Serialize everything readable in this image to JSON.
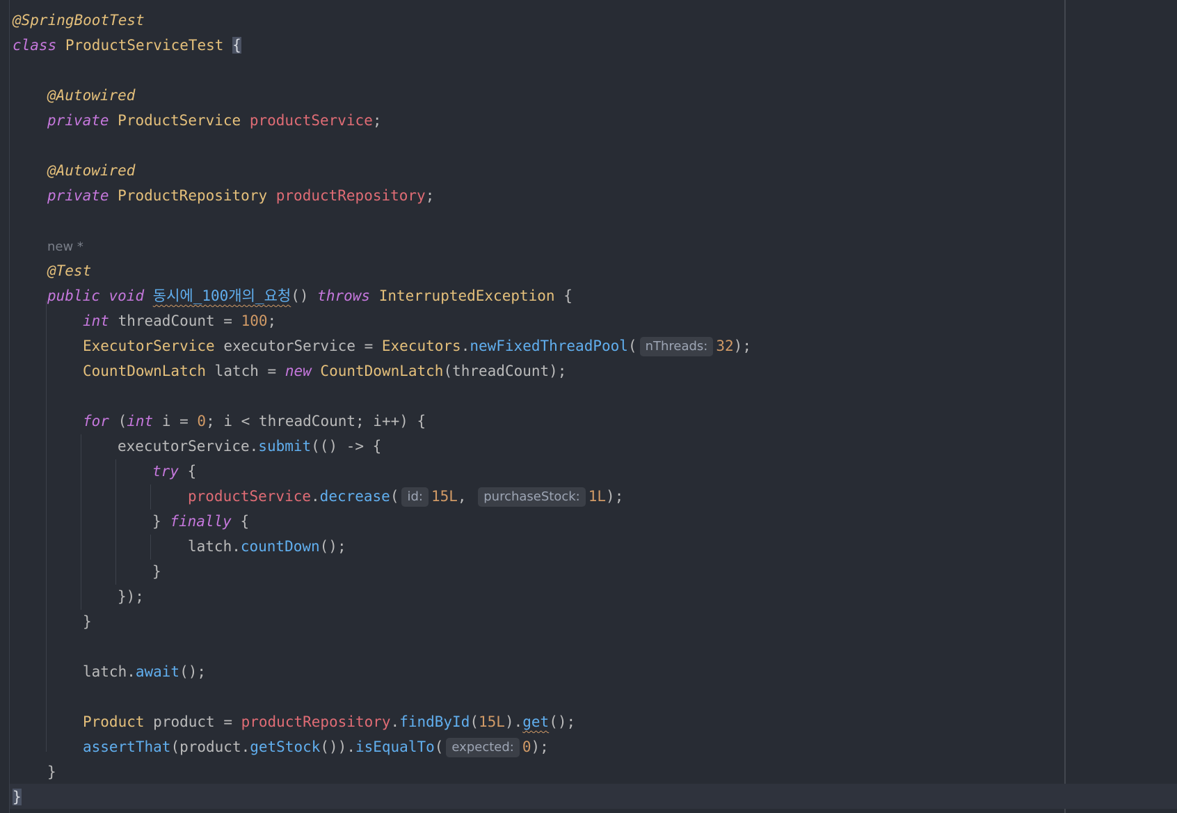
{
  "editor": {
    "language": "Java",
    "lines": {
      "l1_ann": "@SpringBootTest",
      "l2_kw": "class",
      "l2_name": "ProductServiceTest",
      "l2_brace": "{",
      "l4_ann": "@Autowired",
      "l5_kw": "private",
      "l5_type": "ProductService",
      "l5_field": "productService",
      "l5_end": ";",
      "l7_ann": "@Autowired",
      "l8_kw": "private",
      "l8_type": "ProductRepository",
      "l8_field": "productRepository",
      "l8_end": ";",
      "l10_meta": "new *",
      "l11_ann": "@Test",
      "l12_kw1": "public",
      "l12_kw2": "void",
      "l12_method": "동시에_100개의_요청",
      "l12_parens": "()",
      "l12_kw3": "throws",
      "l12_type": "InterruptedException",
      "l12_brace": "{",
      "l13_kw": "int",
      "l13_var": "threadCount = ",
      "l13_num": "100",
      "l13_end": ";",
      "l14_type": "ExecutorService",
      "l14_var": "executorService = ",
      "l14_type2": "Executors",
      "l14_dot": ".",
      "l14_method": "newFixedThreadPool",
      "l14_open": "(",
      "l14_hint": "nThreads:",
      "l14_num": "32",
      "l14_end": ");",
      "l15_type": "CountDownLatch",
      "l15_var": "latch = ",
      "l15_kw": "new",
      "l15_type2": "CountDownLatch",
      "l15_end": "(threadCount);",
      "l17_kw": "for",
      "l17_open": "(",
      "l17_kw2": "int",
      "l17_mid1": "i = ",
      "l17_num": "0",
      "l17_mid2": "; i < threadCount; i++) {",
      "l18_var": "executorService.",
      "l18_method": "submit",
      "l18_end": "(() -> {",
      "l19_kw": "try",
      "l19_brace": "{",
      "l20_field": "productService",
      "l20_dot": ".",
      "l20_method": "decrease",
      "l20_open": "(",
      "l20_hint1": "id:",
      "l20_num1": "15L",
      "l20_comma": ",",
      "l20_hint2": "purchaseStock:",
      "l20_num2": "1L",
      "l20_end": ");",
      "l21_close": "}",
      "l21_kw": "finally",
      "l21_brace": "{",
      "l22_var": "latch.",
      "l22_method": "countDown",
      "l22_end": "();",
      "l23": "}",
      "l24": "});",
      "l25": "}",
      "l27_var": "latch.",
      "l27_method": "await",
      "l27_end": "();",
      "l29_type": "Product",
      "l29_var": "product = ",
      "l29_field": "productRepository",
      "l29_dot": ".",
      "l29_method": "findById",
      "l29_open": "(",
      "l29_num": "15L",
      "l29_close": ").",
      "l29_method2": "get",
      "l29_end": "();",
      "l30_method": "assertThat",
      "l30_mid": "(product.",
      "l30_method2": "getStock",
      "l30_mid2": "()).",
      "l30_method3": "isEqualTo",
      "l30_open": "(",
      "l30_hint": "expected:",
      "l30_num": "0",
      "l30_end": ");",
      "l31": "}",
      "l32": "}"
    }
  }
}
